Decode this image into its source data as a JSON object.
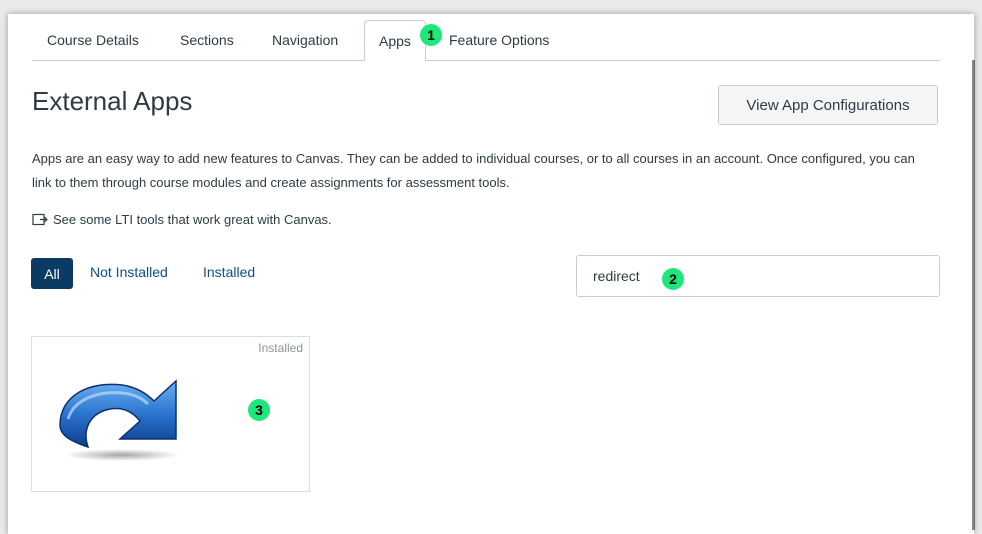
{
  "tabs": [
    {
      "label": "Course Details"
    },
    {
      "label": "Sections"
    },
    {
      "label": "Navigation"
    },
    {
      "label": "Apps"
    },
    {
      "label": "Feature Options"
    }
  ],
  "active_tab": "Apps",
  "heading": "External Apps",
  "view_config_button": "View App Configurations",
  "description": "Apps are an easy way to add new features to Canvas. They can be added to individual courses, or to all courses in an account. Once configured, you can link to them through course modules and create assignments for assessment tools.",
  "lti_link": {
    "text": "See some LTI tools that work great with Canvas.",
    "icon": "external-link-icon"
  },
  "filters": {
    "all": "All",
    "not_installed": "Not Installed",
    "installed": "Installed",
    "selected": "All"
  },
  "search": {
    "value": "redirect"
  },
  "app_cards": [
    {
      "badge": "Installed",
      "icon": "redirect-arrow-icon"
    }
  ],
  "callouts": [
    "1",
    "2",
    "3"
  ],
  "colors": {
    "primary_button": "#0b3a63",
    "link": "#0c4f8a",
    "callout": "#1de87a",
    "arrow_blue": "#1f63b8"
  }
}
